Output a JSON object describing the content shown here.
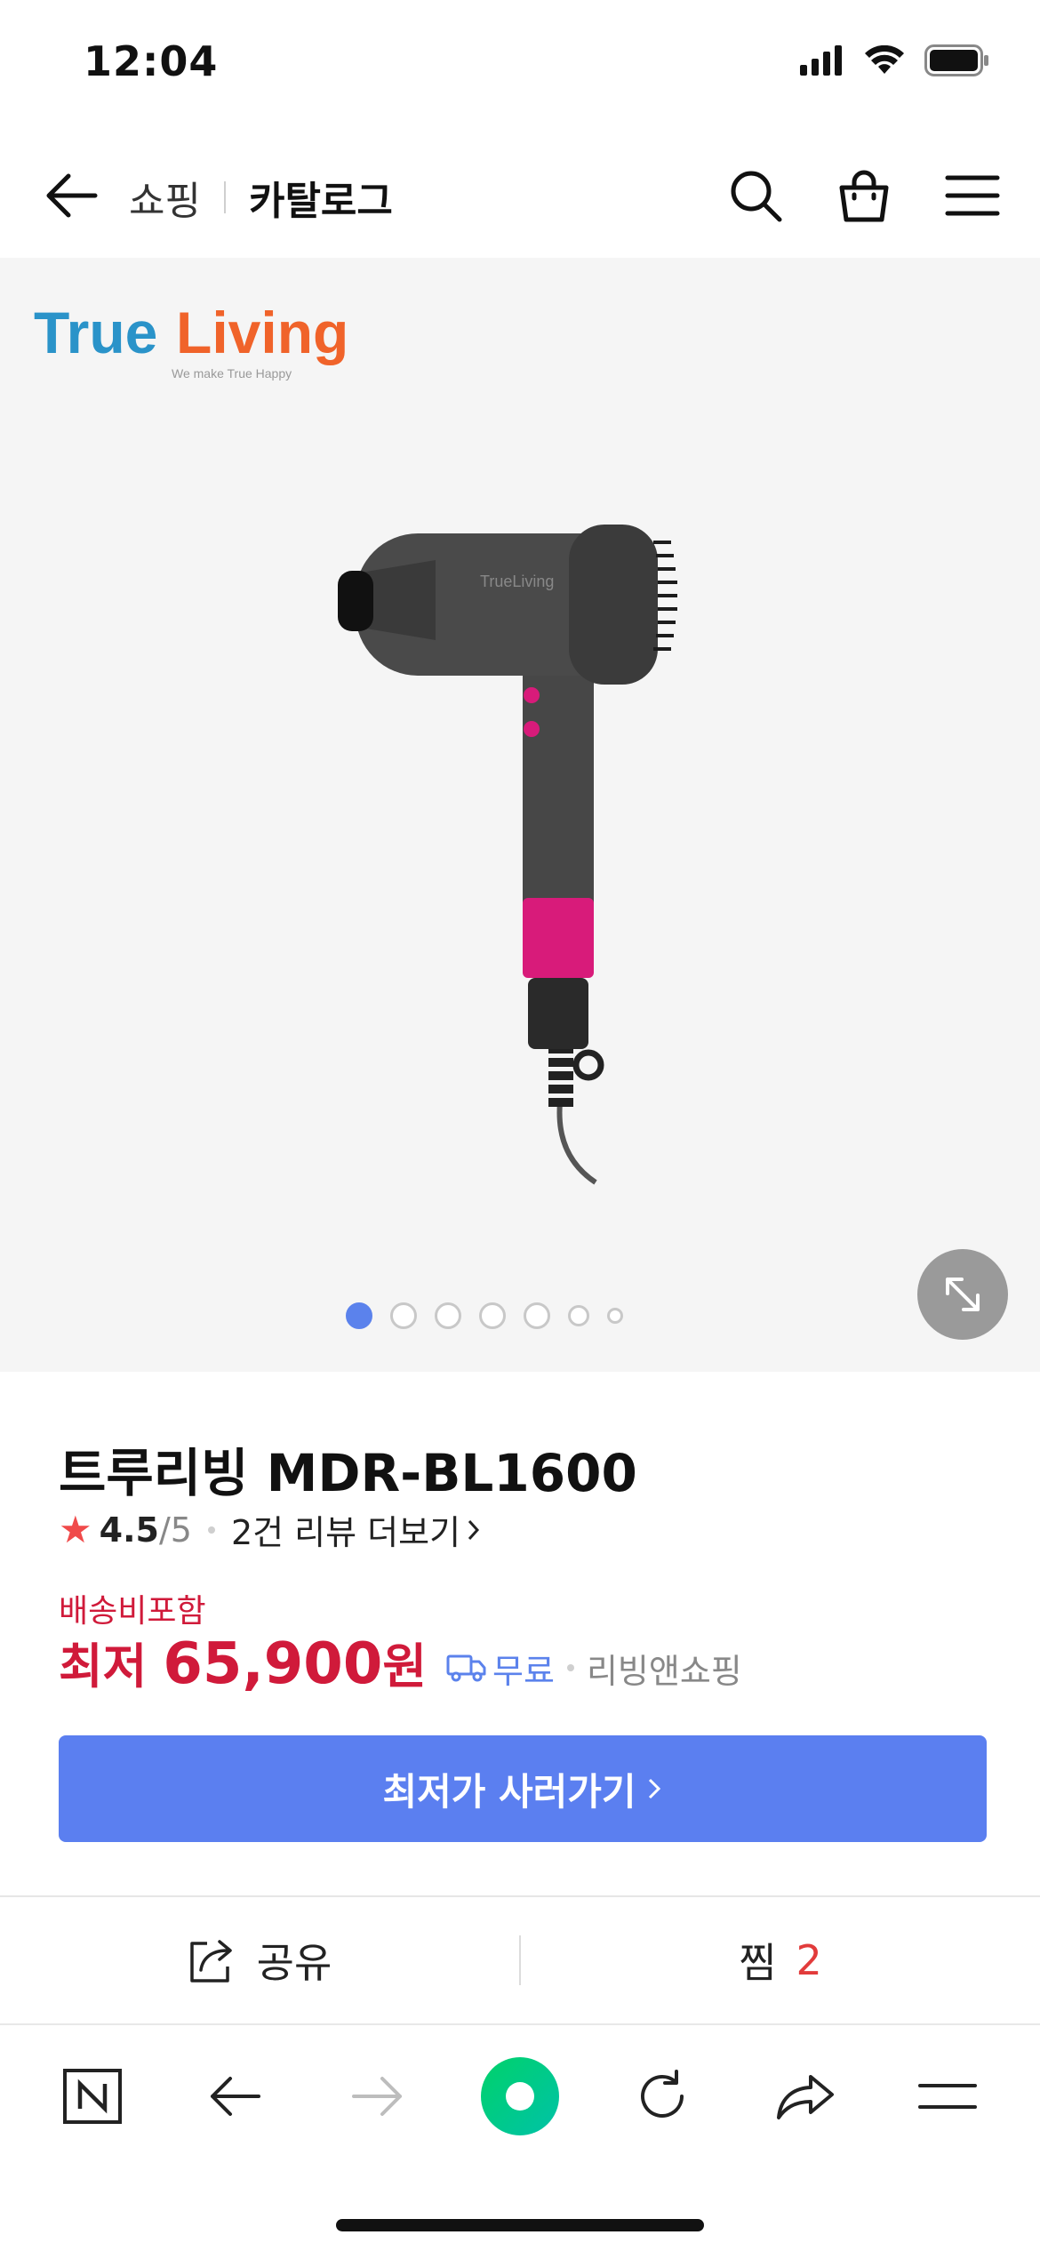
{
  "status_bar": {
    "time": "12:04"
  },
  "top_nav": {
    "breadcrumb_shopping": "쇼핑",
    "breadcrumb_catalog": "카탈로그"
  },
  "gallery": {
    "brand_logo_text": "TrueLiving",
    "brand_tagline": "We make True Happy",
    "image_count": 7,
    "active_index": 0
  },
  "product": {
    "title": "트루리빙 MDR-BL1600",
    "rating": "4.5",
    "rating_max": "/5",
    "review_link": "2건 리뷰 더보기",
    "shipping_note": "배송비포함",
    "price_prefix": "최저",
    "price_value": "65,900",
    "price_unit": "원",
    "shipping_free": "무료",
    "seller": "리빙앤쇼핑",
    "buy_button": "최저가 사러가기"
  },
  "actions": {
    "share_label": "공유",
    "zzim_label": "찜",
    "zzim_count": "2"
  },
  "colors": {
    "accent_blue": "#5b7ff0",
    "price_red": "#d01a3a",
    "star_red": "#f04a4a",
    "naver_green": "#03c75a"
  },
  "icons": [
    "back-arrow-icon",
    "search-icon",
    "shopping-bag-icon",
    "menu-icon",
    "expand-icon",
    "share-icon",
    "naver-n-icon",
    "browser-back-icon",
    "browser-forward-icon",
    "green-dot-icon",
    "refresh-icon",
    "share-arrow-icon",
    "browser-menu-icon"
  ]
}
